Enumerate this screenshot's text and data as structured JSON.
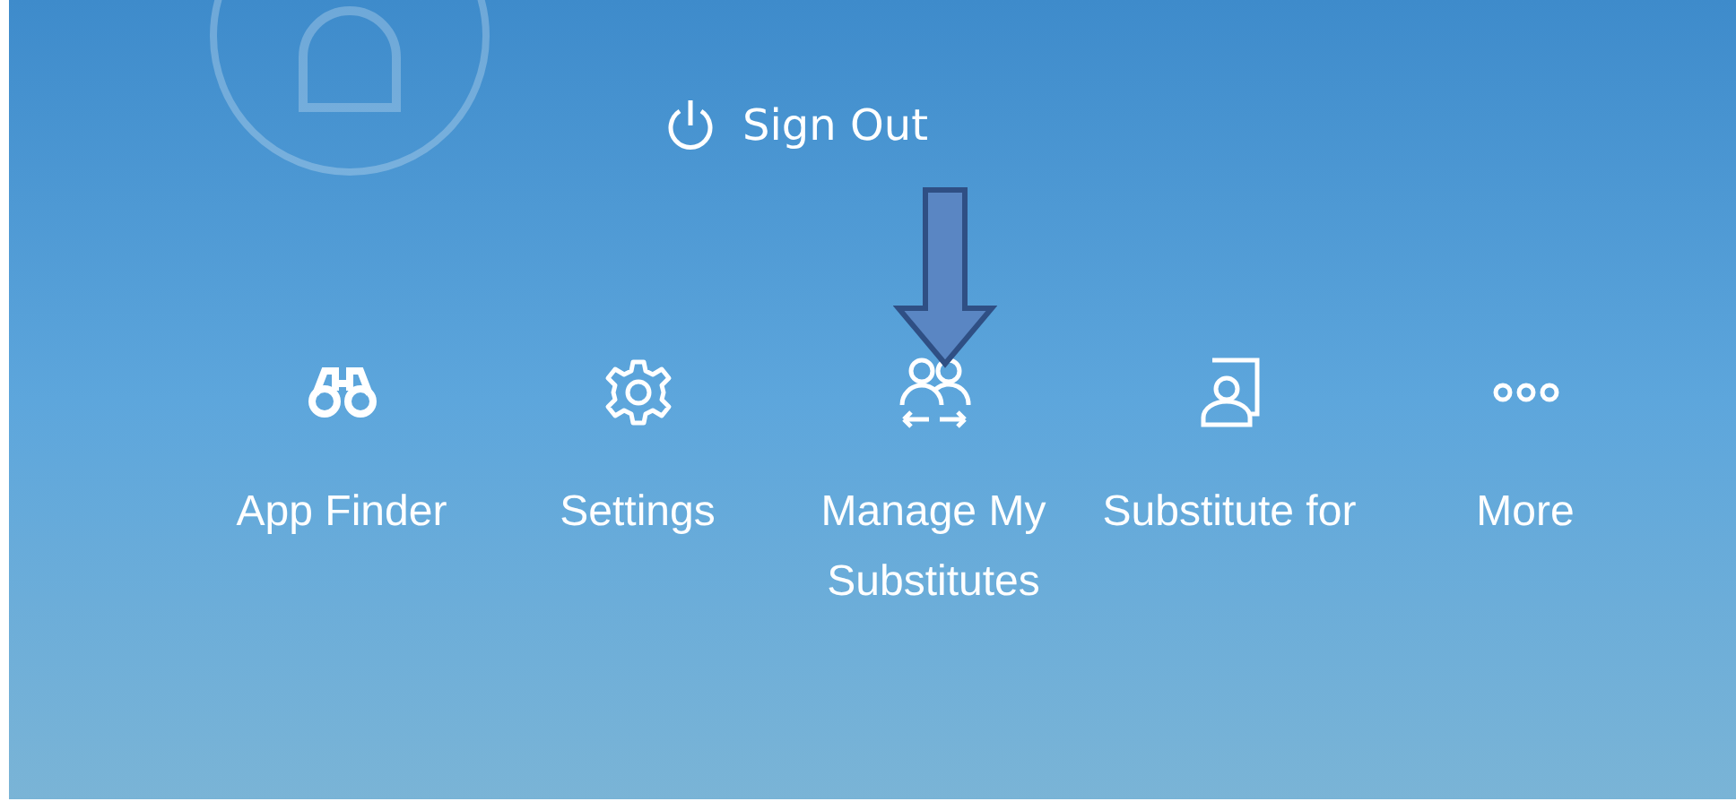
{
  "sign_out": {
    "label": "Sign Out"
  },
  "actions": [
    {
      "kind": "finder",
      "label": "App Finder"
    },
    {
      "kind": "settings",
      "label": "Settings"
    },
    {
      "kind": "substitutes",
      "label": "Manage My Substitutes"
    },
    {
      "kind": "substitute-for",
      "label": "Substitute for"
    },
    {
      "kind": "more",
      "label": "More"
    }
  ]
}
